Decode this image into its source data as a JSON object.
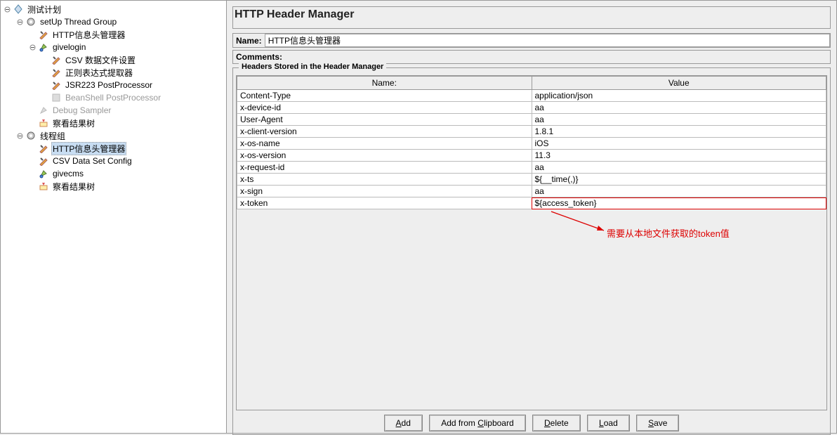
{
  "tree": {
    "root": "测试计划",
    "setup_group": "setUp Thread Group",
    "http_header_mgr": "HTTP信息头管理器",
    "givelogin": "givelogin",
    "csv_data": "CSV 数据文件设置",
    "regex_extractor": "正则表达式提取器",
    "jsr223": "JSR223 PostProcessor",
    "beanshell": "BeanShell PostProcessor",
    "debug_sampler": "Debug Sampler",
    "result_tree1": "察看结果树",
    "thread_group": "线程组",
    "http_header_mgr2": "HTTP信息头管理器",
    "csv_config": "CSV Data Set Config",
    "givecms": "givecms",
    "result_tree2": "察看结果树"
  },
  "panel": {
    "title": "HTTP Header Manager",
    "name_label": "Name:",
    "name_value": "HTTP信息头管理器",
    "comments_label": "Comments:",
    "group_title": "Headers Stored in the Header Manager",
    "col_name": "Name:",
    "col_value": "Value"
  },
  "headers": [
    {
      "name": "Content-Type",
      "value": "application/json"
    },
    {
      "name": "x-device-id",
      "value": "aa"
    },
    {
      "name": "User-Agent",
      "value": "aa"
    },
    {
      "name": "x-client-version",
      "value": "1.8.1"
    },
    {
      "name": "x-os-name",
      "value": "iOS"
    },
    {
      "name": "x-os-version",
      "value": "11.3"
    },
    {
      "name": "x-request-id",
      "value": "aa"
    },
    {
      "name": "x-ts",
      "value": "${__time(,)}"
    },
    {
      "name": "x-sign",
      "value": "aa"
    },
    {
      "name": "x-token",
      "value": "${access_token}"
    }
  ],
  "annotation": "需要从本地文件获取的token值",
  "buttons": {
    "add": "Add",
    "add_clipboard": "Add from Clipboard",
    "delete": "Delete",
    "load": "Load",
    "save": "Save"
  }
}
